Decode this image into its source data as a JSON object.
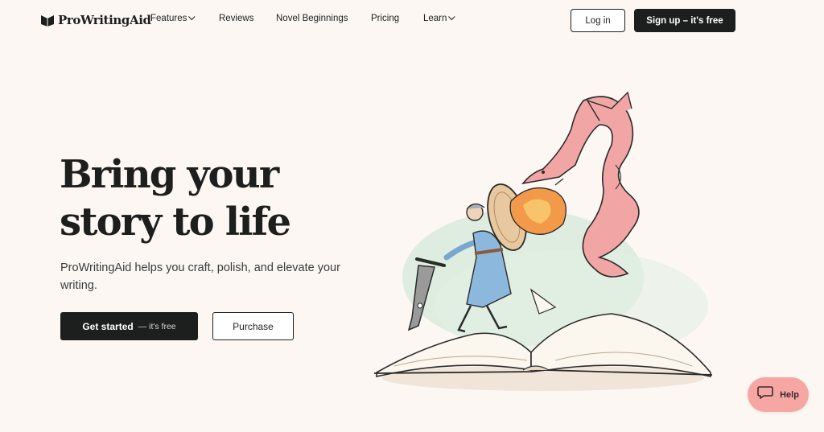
{
  "brand": {
    "name": "ProWritingAid"
  },
  "nav": {
    "items": [
      {
        "label": "Features",
        "dropdown": true
      },
      {
        "label": "Reviews",
        "dropdown": false
      },
      {
        "label": "Novel Beginnings",
        "dropdown": false
      },
      {
        "label": "Pricing",
        "dropdown": false
      },
      {
        "label": "Learn",
        "dropdown": true
      }
    ],
    "login_label": "Log in",
    "signup_label": "Sign up – it's free"
  },
  "hero": {
    "headline_line1": "Bring your",
    "headline_line2": "story to life",
    "subtext": "ProWritingAid helps you craft, polish, and elevate your writing.",
    "primary_cta_label": "Get started",
    "primary_cta_sub": "— it's free",
    "secondary_cta_label": "Purchase"
  },
  "help": {
    "label": "Help"
  },
  "colors": {
    "background": "#fcf7f3",
    "ink": "#1d1f1e",
    "help_pink": "#f6a7a3",
    "dragon_pink": "#f2a5a5",
    "wash_green": "#d4ead8"
  }
}
